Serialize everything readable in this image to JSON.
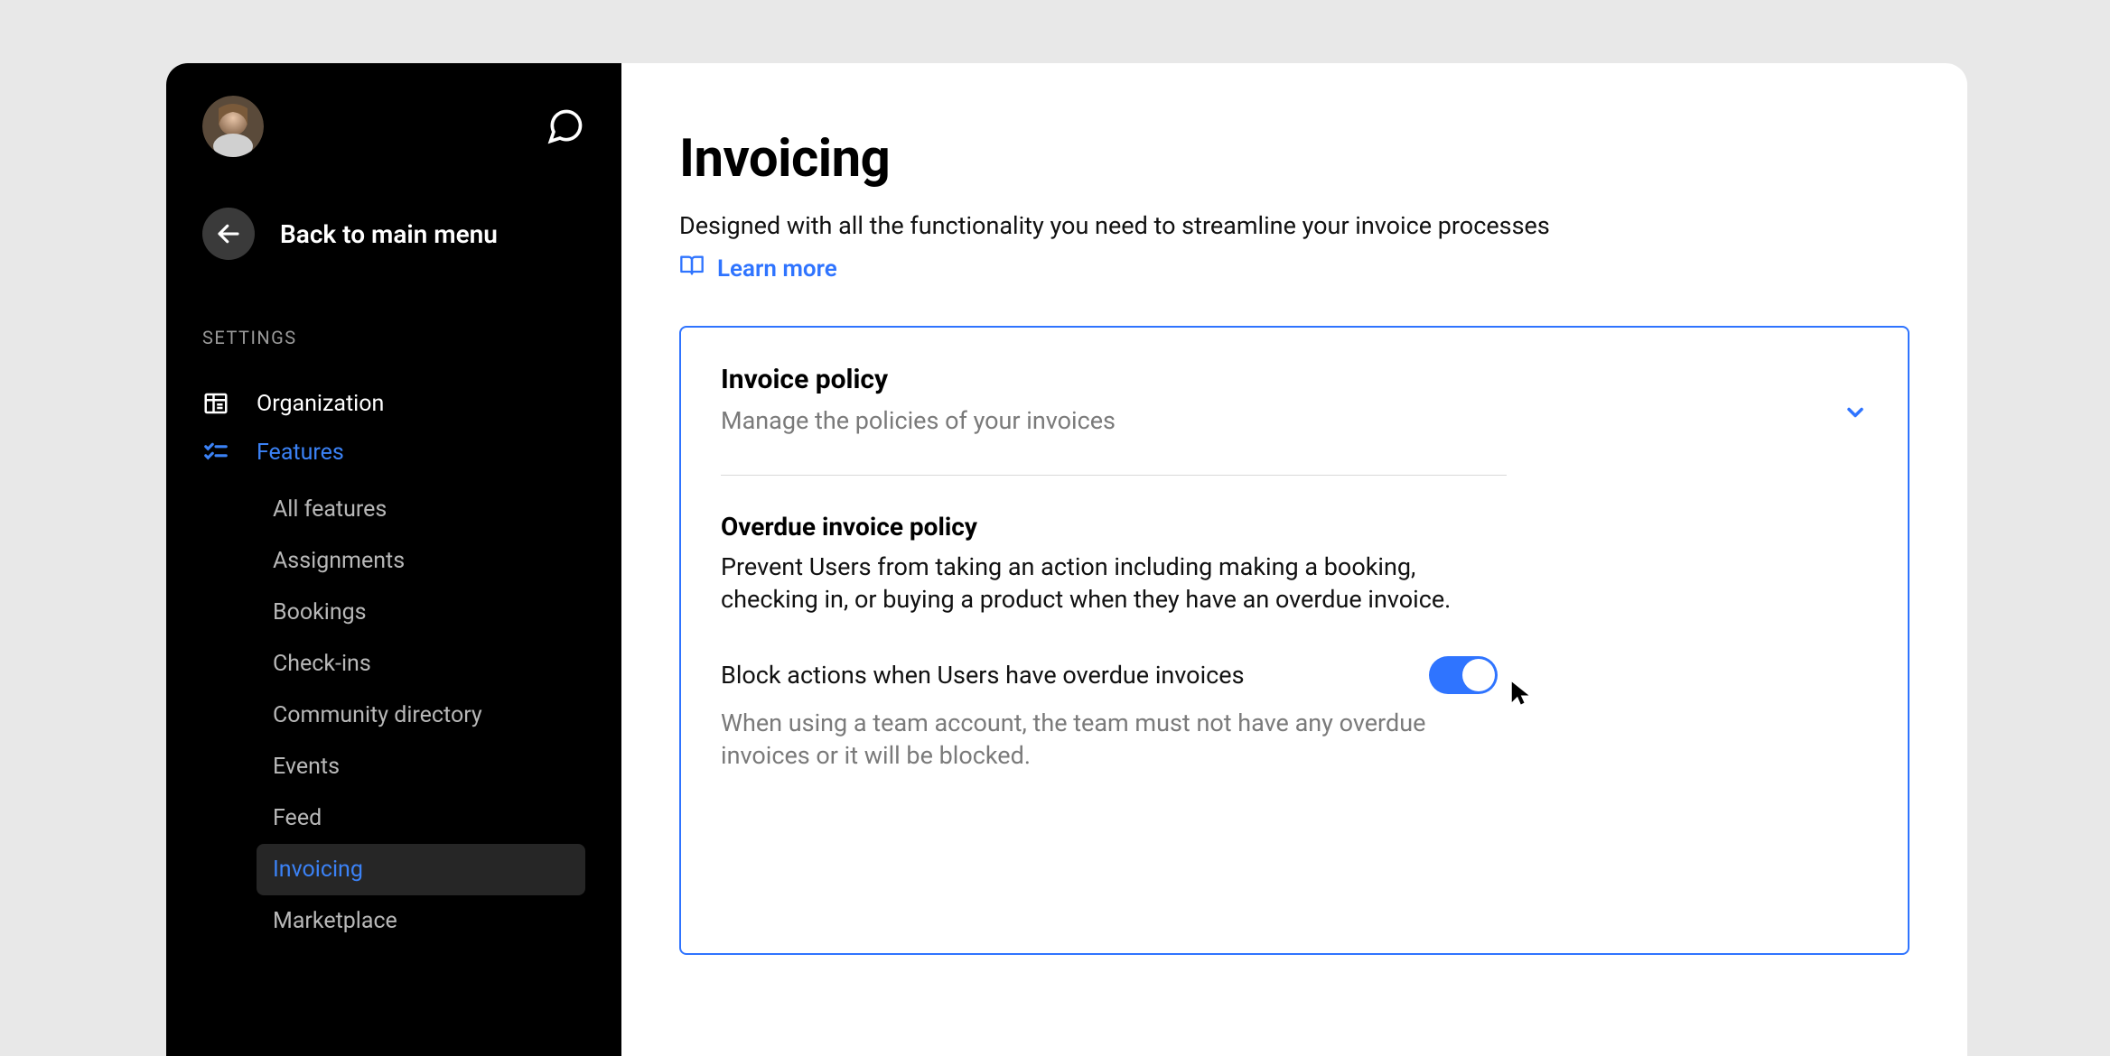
{
  "sidebar": {
    "back_label": "Back to main menu",
    "section_label": "SETTINGS",
    "items": [
      {
        "label": "Organization"
      },
      {
        "label": "Features"
      }
    ],
    "features_sub": [
      {
        "label": "All features"
      },
      {
        "label": "Assignments"
      },
      {
        "label": "Bookings"
      },
      {
        "label": "Check-ins"
      },
      {
        "label": "Community directory"
      },
      {
        "label": "Events"
      },
      {
        "label": "Feed"
      },
      {
        "label": "Invoicing"
      },
      {
        "label": "Marketplace"
      }
    ]
  },
  "main": {
    "title": "Invoicing",
    "subtitle": "Designed with all the functionality you need to streamline your invoice processes",
    "learn_more": "Learn more",
    "card": {
      "title": "Invoice policy",
      "subtitle": "Manage the policies of your invoices",
      "policy_title": "Overdue invoice policy",
      "policy_desc": "Prevent Users from taking an action including making a booking, checking in, or buying a product when they have an overdue invoice.",
      "toggle_label": "Block actions when Users have overdue invoices",
      "toggle_helper": "When using a team account, the team must not have any overdue invoices or it will be blocked."
    }
  }
}
